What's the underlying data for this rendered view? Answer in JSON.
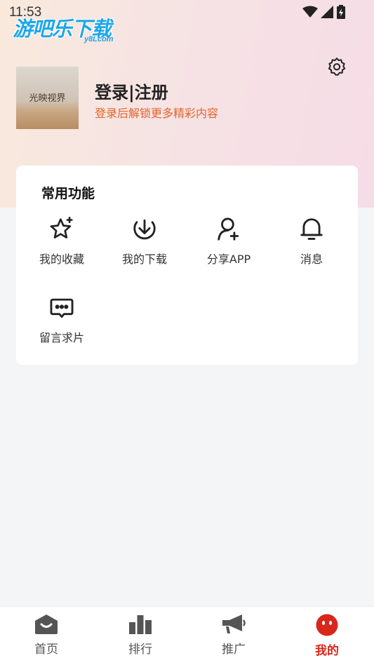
{
  "status_bar": {
    "time": "11:53"
  },
  "watermark": {
    "main": "游吧乐下载",
    "sub": "y8Lcom"
  },
  "profile": {
    "avatar_text": "光映视界",
    "title": "登录|注册",
    "subtitle": "登录后解锁更多精彩内容"
  },
  "features": {
    "title": "常用功能",
    "items": [
      {
        "label": "我的收藏",
        "icon": "star-icon"
      },
      {
        "label": "我的下载",
        "icon": "download-icon"
      },
      {
        "label": "分享APP",
        "icon": "add-user-icon"
      },
      {
        "label": "消息",
        "icon": "bell-icon"
      },
      {
        "label": "留言求片",
        "icon": "message-icon"
      }
    ]
  },
  "nav": {
    "items": [
      {
        "label": "首页",
        "icon": "home-icon"
      },
      {
        "label": "排行",
        "icon": "ranking-icon"
      },
      {
        "label": "推广",
        "icon": "megaphone-icon"
      },
      {
        "label": "我的",
        "icon": "profile-face-icon"
      }
    ],
    "active": "我的"
  },
  "colors": {
    "accent": "#d8271c",
    "subtitle": "#e2642b",
    "watermark": "#1ea7e8"
  }
}
